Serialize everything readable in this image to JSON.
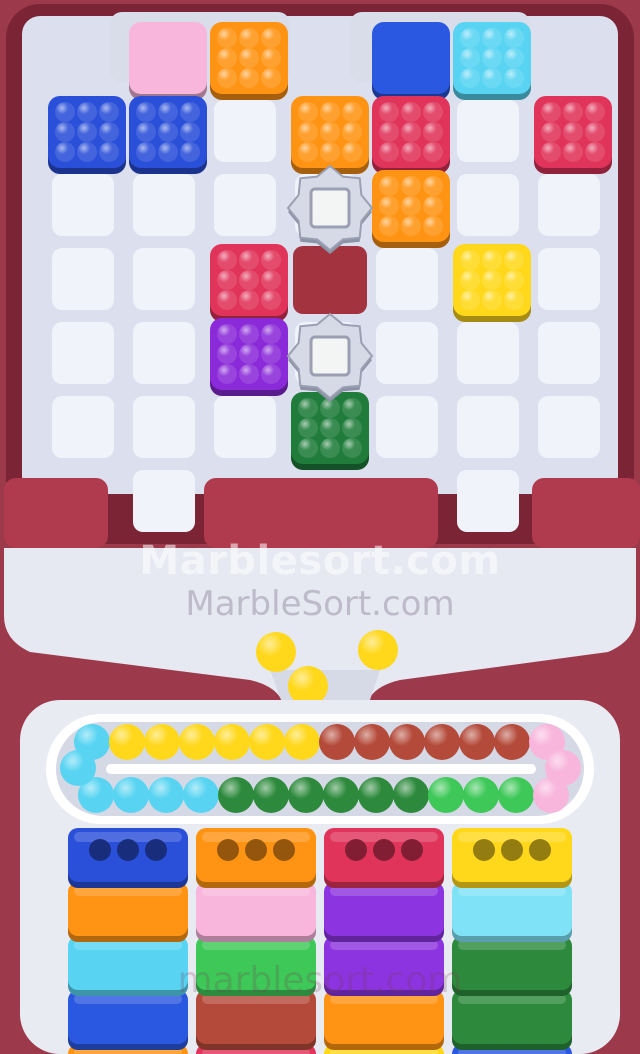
{
  "game": {
    "title": "Marble Sort",
    "watermark_primary": "Marblesort.com",
    "watermark_secondary": "MarbleSort.com",
    "watermark_tertiary": "marblesort.com"
  },
  "colors": {
    "frame": "#9c3a4c",
    "frame_dark": "#7a2436",
    "board": "#dcdfee",
    "cell": "#f1f3fb",
    "dark_slot": "#a3343f",
    "blue": "#2a4fd8",
    "orange": "#ff9414",
    "pink": "#f8b6dc",
    "red": "#e0345a",
    "cyan": "#58d4f2",
    "yellow": "#ffd81c",
    "purple": "#8a2ad8",
    "green": "#1f7c3a",
    "brown": "#b44a3a",
    "lime": "#3ec858",
    "violet": "#8c34e0",
    "lightcyan": "#7fe2f6",
    "royal": "#2a58e0",
    "darkgreen": "#2d8a3c"
  },
  "board": {
    "blocks": [
      {
        "color": "orange",
        "col": 2,
        "row": 0,
        "kind": "marble"
      },
      {
        "color": "cyan",
        "col": 5,
        "row": 0,
        "kind": "marble"
      },
      {
        "color": "pink",
        "col": 1,
        "row": 0,
        "kind": "plain"
      },
      {
        "color": "royal",
        "col": 4,
        "row": 0,
        "kind": "plain"
      },
      {
        "color": "blue",
        "col": 0,
        "row": 1,
        "kind": "marble"
      },
      {
        "color": "blue",
        "col": 1,
        "row": 1,
        "kind": "marble"
      },
      {
        "color": "orange",
        "col": 3,
        "row": 1,
        "kind": "marble"
      },
      {
        "color": "red",
        "col": 4,
        "row": 1,
        "kind": "marble"
      },
      {
        "color": "red",
        "col": 6,
        "row": 1,
        "kind": "marble"
      },
      {
        "color": "orange",
        "col": 4,
        "row": 2,
        "kind": "marble"
      },
      {
        "color": "red",
        "col": 2,
        "row": 3,
        "kind": "marble"
      },
      {
        "color": "yellow",
        "col": 5,
        "row": 3,
        "kind": "marble"
      },
      {
        "color": "purple",
        "col": 2,
        "row": 4,
        "kind": "marble"
      },
      {
        "color": "green",
        "col": 3,
        "row": 5,
        "kind": "marble"
      }
    ],
    "spinners": [
      {
        "col": 3,
        "row": 2
      },
      {
        "col": 3,
        "row": 4
      }
    ],
    "dark_slots": [
      {
        "col": 3,
        "row": 3
      }
    ]
  },
  "falling_balls": [
    "yellow",
    "yellow",
    "yellow"
  ],
  "conveyor": {
    "top_row": [
      "cyan",
      "yellow",
      "yellow",
      "yellow",
      "yellow",
      "yellow",
      "yellow",
      "brown",
      "brown",
      "brown",
      "brown",
      "brown",
      "brown",
      "pink"
    ],
    "bottom_row": [
      "cyan",
      "cyan",
      "cyan",
      "cyan",
      "darkgreen",
      "darkgreen",
      "darkgreen",
      "darkgreen",
      "darkgreen",
      "darkgreen",
      "lime",
      "lime",
      "lime",
      "pink"
    ],
    "left_cap": "cyan",
    "right_cap": "pink"
  },
  "trays": {
    "columns": [
      [
        "blue",
        "orange",
        "cyan",
        "royal",
        "orange"
      ],
      [
        "orange",
        "pink",
        "lime",
        "brown",
        "red"
      ],
      [
        "red",
        "violet",
        "violet",
        "orange",
        "yellow"
      ],
      [
        "yellow",
        "lightcyan",
        "darkgreen",
        "darkgreen",
        "royal"
      ]
    ]
  }
}
